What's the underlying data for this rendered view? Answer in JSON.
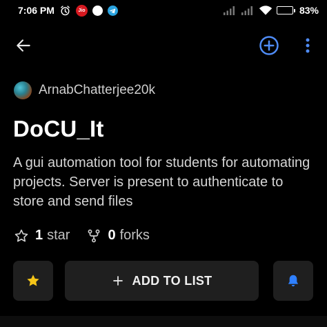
{
  "status_bar": {
    "time": "7:06 PM",
    "carrier_badge": "Jio",
    "battery_percent": "83%",
    "battery_level": 0.83,
    "left_icons": [
      "alarm-icon",
      "jio-icon",
      "circle-notification-icon",
      "telegram-icon"
    ],
    "right_icons": [
      "signal-icon",
      "signal-icon",
      "wifi-icon",
      "battery-icon"
    ]
  },
  "app_bar": {
    "icons": [
      "back-arrow-icon",
      "add-circle-icon",
      "more-vert-icon"
    ],
    "accent_color": "#4f8cf6"
  },
  "repo": {
    "owner": "ArnabChatterjee20k",
    "name": "DoCU_It",
    "description": "A gui automation tool for students for automating projects. Server is present to authenticate to store and send files",
    "stars_count": "1",
    "stars_label": "star",
    "forks_count": "0",
    "forks_label": "forks"
  },
  "actions": {
    "add_to_list_label": "ADD TO LIST",
    "star_icon_color": "#f5c518",
    "bell_icon_color": "#2f80ff"
  }
}
